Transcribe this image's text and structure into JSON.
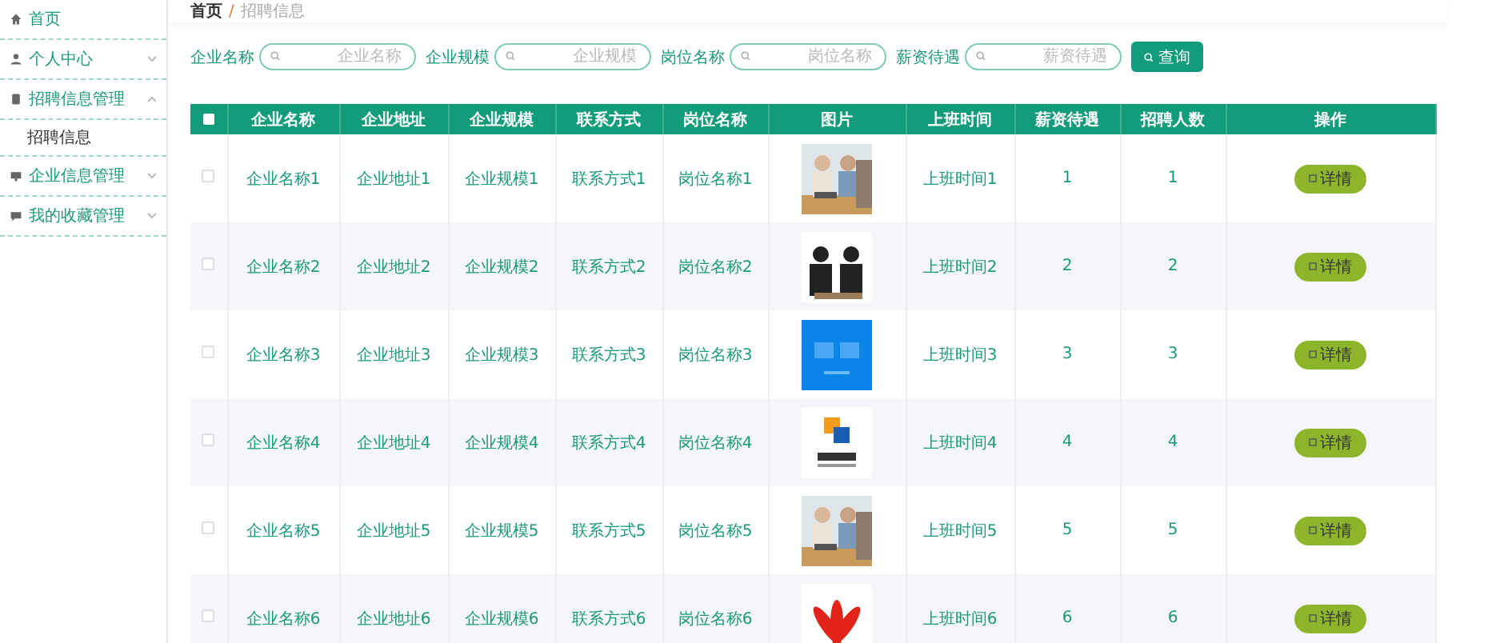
{
  "sidebar": {
    "items": [
      {
        "label": "首页"
      },
      {
        "label": "个人中心",
        "expanded": false
      },
      {
        "label": "招聘信息管理",
        "expanded": true,
        "children": [
          {
            "label": "招聘信息"
          }
        ]
      },
      {
        "label": "企业信息管理",
        "expanded": false
      },
      {
        "label": "我的收藏管理",
        "expanded": false
      }
    ]
  },
  "breadcrumb": {
    "separator": "/",
    "items": [
      "首页",
      "招聘信息"
    ]
  },
  "search": {
    "fields": [
      {
        "label": "企业名称",
        "placeholder": "企业名称"
      },
      {
        "label": "企业规模",
        "placeholder": "企业规模"
      },
      {
        "label": "岗位名称",
        "placeholder": "岗位名称"
      },
      {
        "label": "薪资待遇",
        "placeholder": "薪资待遇"
      }
    ],
    "button": "查询"
  },
  "table": {
    "select_all_checked": false,
    "columns": [
      "企业名称",
      "企业地址",
      "企业规模",
      "联系方式",
      "岗位名称",
      "图片",
      "上班时间",
      "薪资待遇",
      "招聘人数",
      "操作"
    ],
    "rows": [
      {
        "checked": false,
        "cells": [
          "企业名称1",
          "企业地址1",
          "企业规模1",
          "联系方式1",
          "岗位名称1"
        ],
        "image": {
          "kind": "picture"
        },
        "cells_after": [
          "上班时间1",
          "1",
          "1"
        ],
        "action": "详情"
      },
      {
        "checked": false,
        "cells": [
          "企业名称2",
          "企业地址2",
          "企业规模2",
          "联系方式2",
          "岗位名称2"
        ],
        "image": {
          "kind": "picture"
        },
        "cells_after": [
          "上班时间2",
          "2",
          "2"
        ],
        "action": "详情"
      },
      {
        "checked": false,
        "cells": [
          "企业名称3",
          "企业地址3",
          "企业规模3",
          "联系方式3",
          "岗位名称3"
        ],
        "image": {
          "kind": "picture"
        },
        "cells_after": [
          "上班时间3",
          "3",
          "3"
        ],
        "action": "详情"
      },
      {
        "checked": false,
        "cells": [
          "企业名称4",
          "企业地址4",
          "企业规模4",
          "联系方式4",
          "岗位名称4"
        ],
        "image": {
          "kind": "picture"
        },
        "cells_after": [
          "上班时间4",
          "4",
          "4"
        ],
        "action": "详情"
      },
      {
        "checked": false,
        "cells": [
          "企业名称5",
          "企业地址5",
          "企业规模5",
          "联系方式5",
          "岗位名称5"
        ],
        "image": {
          "kind": "picture"
        },
        "cells_after": [
          "上班时间5",
          "5",
          "5"
        ],
        "action": "详情"
      },
      {
        "checked": false,
        "cells": [
          "企业名称6",
          "企业地址6",
          "企业规模6",
          "联系方式6",
          "岗位名称6"
        ],
        "image": {
          "kind": "picture"
        },
        "cells_after": [
          "上班时间6",
          "6",
          "6"
        ],
        "action": "详情"
      }
    ]
  }
}
